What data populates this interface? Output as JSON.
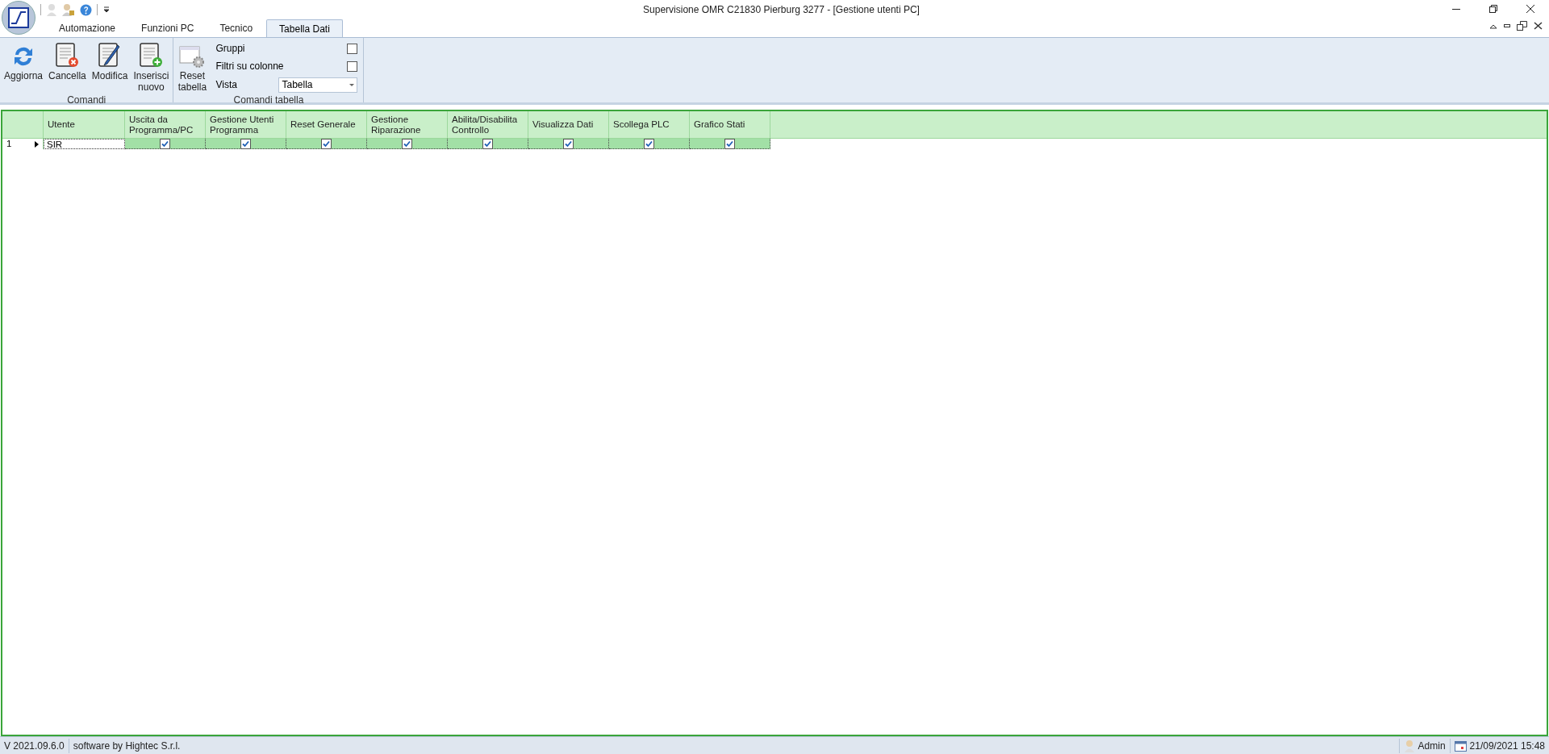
{
  "window": {
    "title": "Supervisione OMR C21830 Pierburg 3277 - [Gestione utenti PC]"
  },
  "tabs": [
    {
      "label": "Automazione",
      "selected": false
    },
    {
      "label": "Funzioni PC",
      "selected": false
    },
    {
      "label": "Tecnico",
      "selected": false
    },
    {
      "label": "Tabella Dati",
      "selected": true
    }
  ],
  "ribbon": {
    "groups": [
      {
        "title": "Comandi",
        "buttons": [
          {
            "label": "Aggiorna",
            "kind": "refresh"
          },
          {
            "label": "Cancella",
            "kind": "delete"
          },
          {
            "label": "Modifica",
            "kind": "edit"
          },
          {
            "label": "Inserisci nuovo",
            "kind": "add"
          }
        ]
      },
      {
        "title": "Comandi tabella",
        "buttons": [
          {
            "label": "Reset tabella",
            "kind": "reset"
          }
        ],
        "options": [
          {
            "label": "Gruppi",
            "checked": false
          },
          {
            "label": "Filtri su colonne",
            "checked": false
          }
        ],
        "view": {
          "label": "Vista",
          "value": "Tabella"
        }
      }
    ]
  },
  "table": {
    "columns": [
      "Utente",
      "Uscita da Programma/PC",
      "Gestione Utenti Programma",
      "Reset Generale",
      "Gestione Riparazione",
      "Abilita/Disabilita Controllo",
      "Visualizza Dati",
      "Scollega PLC",
      "Grafico Stati"
    ],
    "rows": [
      {
        "index": "1",
        "current": true,
        "utente": "SIR",
        "permissions": [
          true,
          true,
          true,
          true,
          true,
          true,
          true,
          true
        ]
      }
    ]
  },
  "status_bar": {
    "version": "V 2021.09.6.0",
    "credits": "software by Hightec S.r.l.",
    "user": "Admin",
    "datetime": "21/09/2021 15:48"
  }
}
